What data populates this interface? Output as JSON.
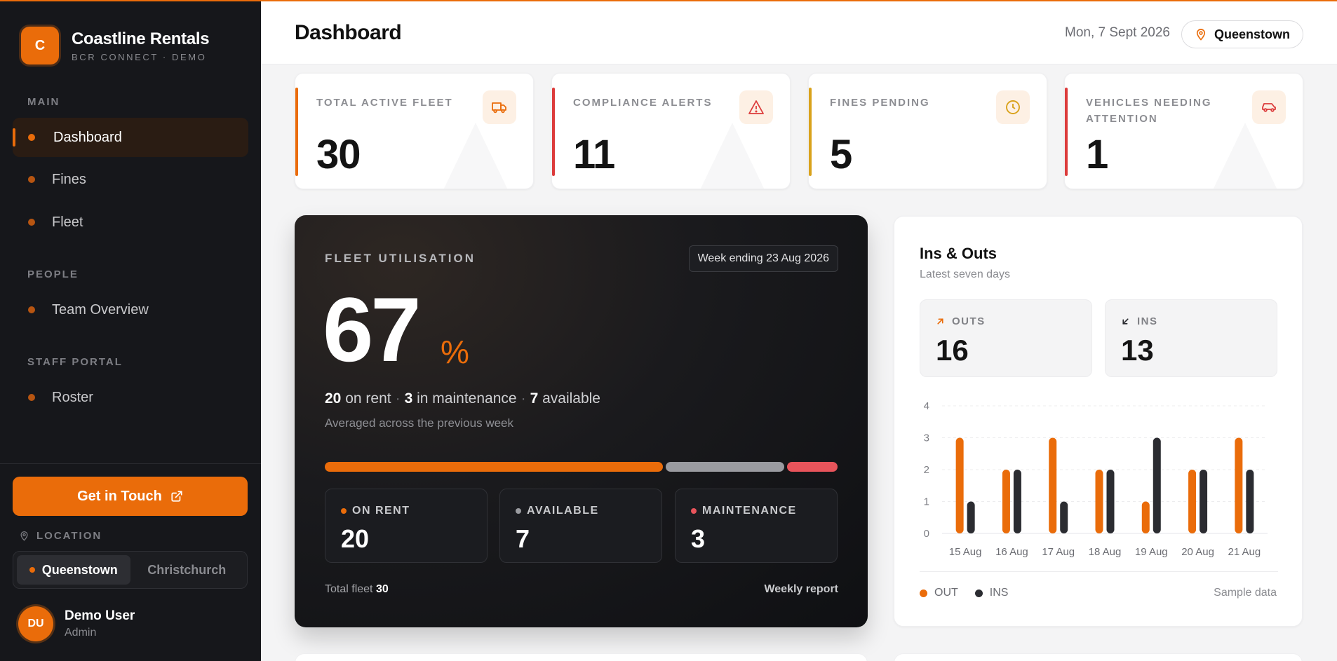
{
  "brand": {
    "logo_letter": "C",
    "name": "Coastline Rentals",
    "subtitle": "BCR CONNECT · DEMO"
  },
  "sidebar": {
    "sections": [
      "MAIN",
      "PEOPLE",
      "STAFF PORTAL"
    ],
    "items": [
      {
        "label": "Dashboard",
        "active": true
      },
      {
        "label": "Fines"
      },
      {
        "label": "Fleet"
      },
      {
        "label": "Team Overview"
      },
      {
        "label": "Roster"
      }
    ],
    "cta_label": "Get in Touch",
    "location_label": "LOCATION",
    "locations": [
      "Queenstown",
      "Christchurch"
    ],
    "selected_location": "Queenstown"
  },
  "user": {
    "initials": "DU",
    "name": "Demo User",
    "role": "Admin"
  },
  "header": {
    "title": "Dashboard",
    "date": "Mon, 7 Sept 2026",
    "location": "Queenstown"
  },
  "kpis": [
    {
      "label": "TOTAL ACTIVE FLEET",
      "value": "30",
      "icon": "truck-icon",
      "accent": "#ea6c0a"
    },
    {
      "label": "COMPLIANCE ALERTS",
      "value": "11",
      "icon": "warning-icon",
      "accent": "#dc3b3b"
    },
    {
      "label": "FINES PENDING",
      "value": "5",
      "icon": "clock-icon",
      "accent": "#d9a21b"
    },
    {
      "label": "VEHICLES NEEDING ATTENTION",
      "value": "1",
      "icon": "car-icon",
      "accent": "#dc3b3b"
    }
  ],
  "utilisation": {
    "label": "FLEET UTILISATION",
    "week": "Week ending 23 Aug 2026",
    "percent": "67",
    "percent_sign": "%",
    "on_rent": "20",
    "on_rent_text": "on rent",
    "maintenance": "3",
    "maintenance_text": "in maintenance",
    "available": "7",
    "available_text": "available",
    "note": "Averaged across the previous week",
    "bar_fractions": {
      "on_rent": 0.667,
      "available": 0.233,
      "maintenance": 0.1
    },
    "stats": [
      {
        "label": "ON RENT",
        "value": "20",
        "color": "#ea6c0a"
      },
      {
        "label": "AVAILABLE",
        "value": "7",
        "color": "#9a9ba0"
      },
      {
        "label": "MAINTENANCE",
        "value": "3",
        "color": "#e8545b"
      }
    ],
    "total_label": "Total fleet",
    "total_value": "30",
    "report_link": "Weekly report"
  },
  "ins_outs": {
    "title": "Ins & Outs",
    "subtitle": "Latest seven days",
    "outs_label": "OUTS",
    "outs_value": "16",
    "ins_label": "INS",
    "ins_value": "13",
    "legend_out": "OUT",
    "legend_ins": "INS",
    "note": "Sample data"
  },
  "chart_data": {
    "type": "bar",
    "categories": [
      "15 Aug",
      "16 Aug",
      "17 Aug",
      "18 Aug",
      "19 Aug",
      "20 Aug",
      "21 Aug"
    ],
    "series": [
      {
        "name": "OUT",
        "values": [
          3,
          2,
          3,
          2,
          1,
          2,
          3
        ],
        "color": "#ea6c0a"
      },
      {
        "name": "INS",
        "values": [
          1,
          2,
          1,
          2,
          3,
          2,
          2
        ],
        "color": "#2b2c31"
      }
    ],
    "yticks": [
      0,
      1,
      2,
      3,
      4
    ],
    "ylim": [
      0,
      4
    ],
    "grid": true,
    "legend": "bottom-left"
  }
}
